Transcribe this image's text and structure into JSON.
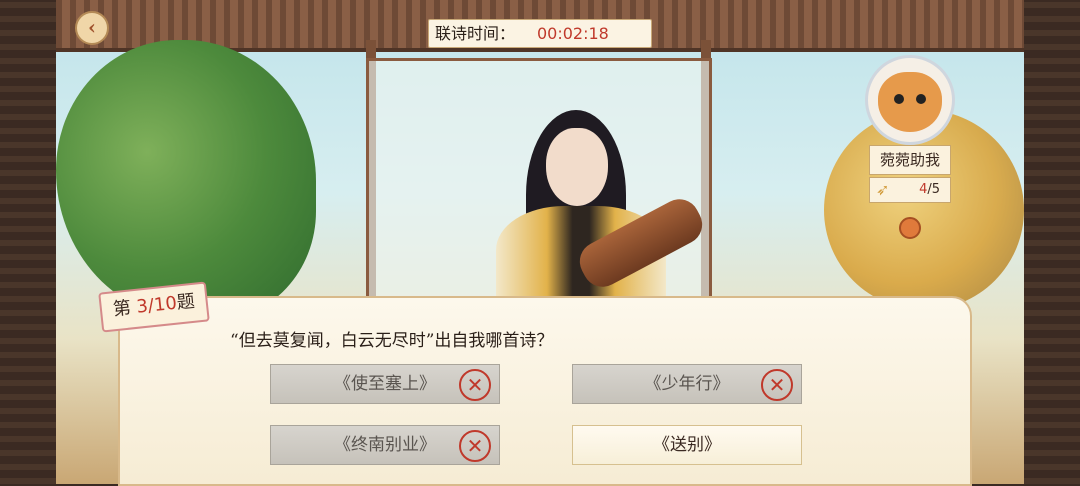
{
  "header": {
    "back_icon": "chevron-left-icon",
    "timer_label": "联诗时间：",
    "timer_value": "00:02:18"
  },
  "helper": {
    "label": "菀菀助我",
    "count_used": "4",
    "count_total": "/5",
    "feather_icon": "feather-icon",
    "bell_icon": "bell-icon"
  },
  "question": {
    "tag_prefix": "第",
    "tag_current": "3",
    "tag_total": "/10",
    "tag_suffix": "题",
    "text": "“但去莫复闻，白云无尽时”出自我哪首诗？"
  },
  "options": [
    {
      "label": "《使至塞上》",
      "state": "wrong"
    },
    {
      "label": "《少年行》",
      "state": "wrong"
    },
    {
      "label": "《终南别业》",
      "state": "wrong"
    },
    {
      "label": "《送别》",
      "state": "available"
    }
  ],
  "wrong_mark": "✕",
  "colors": {
    "accent_red": "#c0392b",
    "wood": "#7b5138",
    "paper": "#fdf8ec"
  }
}
